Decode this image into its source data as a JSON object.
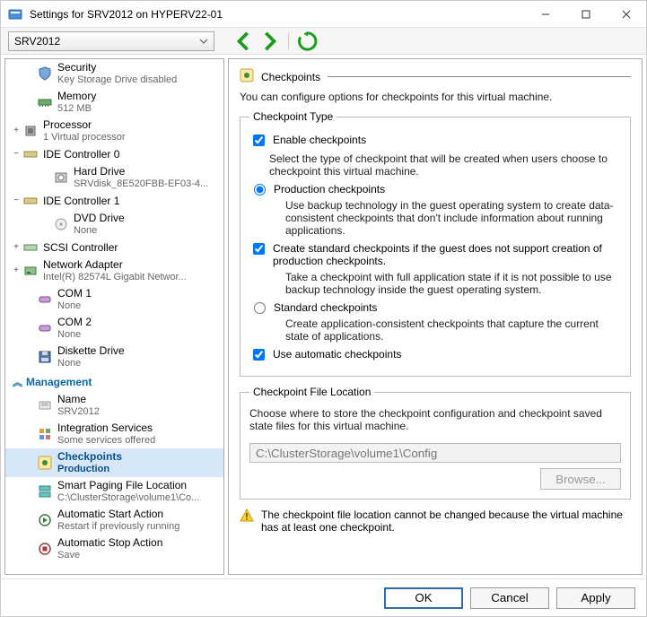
{
  "window": {
    "title": "Settings for SRV2012 on HYPERV22-01"
  },
  "toolbar": {
    "vm_selected": "SRV2012"
  },
  "nav": {
    "hardware": [
      {
        "id": "security",
        "label": "Security",
        "sub": "Key Storage Drive disabled",
        "icon": "shield-icon",
        "expander": "",
        "indent": 1
      },
      {
        "id": "memory",
        "label": "Memory",
        "sub": "512 MB",
        "icon": "memory-icon",
        "expander": "",
        "indent": 1
      },
      {
        "id": "processor",
        "label": "Processor",
        "sub": "1 Virtual processor",
        "icon": "cpu-icon",
        "expander": "+",
        "indent": 0
      },
      {
        "id": "ide0",
        "label": "IDE Controller 0",
        "sub": "",
        "icon": "ide-icon",
        "expander": "−",
        "indent": 0
      },
      {
        "id": "hard-drive",
        "label": "Hard Drive",
        "sub": "SRVdisk_8E520FBB-EF03-4...",
        "icon": "disk-icon",
        "expander": "",
        "indent": 2
      },
      {
        "id": "ide1",
        "label": "IDE Controller 1",
        "sub": "",
        "icon": "ide-icon",
        "expander": "−",
        "indent": 0
      },
      {
        "id": "dvd",
        "label": "DVD Drive",
        "sub": "None",
        "icon": "dvd-icon",
        "expander": "",
        "indent": 2
      },
      {
        "id": "scsi",
        "label": "SCSI Controller",
        "sub": "",
        "icon": "scsi-icon",
        "expander": "+",
        "indent": 0
      },
      {
        "id": "nic",
        "label": "Network Adapter",
        "sub": "Intel(R) 82574L Gigabit Networ...",
        "icon": "nic-icon",
        "expander": "+",
        "indent": 0
      },
      {
        "id": "com1",
        "label": "COM 1",
        "sub": "None",
        "icon": "com-icon",
        "expander": "",
        "indent": 1
      },
      {
        "id": "com2",
        "label": "COM 2",
        "sub": "None",
        "icon": "com-icon",
        "expander": "",
        "indent": 1
      },
      {
        "id": "diskette",
        "label": "Diskette Drive",
        "sub": "None",
        "icon": "floppy-icon",
        "expander": "",
        "indent": 1
      }
    ],
    "management_header": "Management",
    "management": [
      {
        "id": "name",
        "label": "Name",
        "sub": "SRV2012",
        "icon": "tag-icon"
      },
      {
        "id": "integration",
        "label": "Integration Services",
        "sub": "Some services offered",
        "icon": "services-icon"
      },
      {
        "id": "checkpoints",
        "label": "Checkpoints",
        "sub": "Production",
        "icon": "checkpoint-icon",
        "selected": true
      },
      {
        "id": "paging",
        "label": "Smart Paging File Location",
        "sub": "C:\\ClusterStorage\\volume1\\Co...",
        "icon": "paging-icon"
      },
      {
        "id": "autostart",
        "label": "Automatic Start Action",
        "sub": "Restart if previously running",
        "icon": "autostart-icon"
      },
      {
        "id": "autostop",
        "label": "Automatic Stop Action",
        "sub": "Save",
        "icon": "autostop-icon"
      }
    ]
  },
  "content": {
    "header": "Checkpoints",
    "intro": "You can configure options for checkpoints for this virtual machine.",
    "type_group": "Checkpoint Type",
    "enable_label": "Enable checkpoints",
    "enable_checked": true,
    "select_type_desc": "Select the type of checkpoint that will be created when users choose to checkpoint this virtual machine.",
    "prod_label": "Production checkpoints",
    "prod_selected": true,
    "prod_desc": "Use backup technology in the guest operating system to create data-consistent checkpoints that don't include information about running applications.",
    "fallback_label": "Create standard checkpoints if the guest does not support creation of production checkpoints.",
    "fallback_checked": true,
    "fallback_desc": "Take a checkpoint with full application state if it is not possible to use backup technology inside the guest operating system.",
    "std_label": "Standard checkpoints",
    "std_selected": false,
    "std_desc": "Create application-consistent checkpoints that capture the current state of applications.",
    "auto_label": "Use automatic checkpoints",
    "auto_checked": true,
    "loc_group": "Checkpoint File Location",
    "loc_desc": "Choose where to store the checkpoint configuration and checkpoint saved state files for this virtual machine.",
    "loc_path": "C:\\ClusterStorage\\volume1\\Config",
    "browse_label": "Browse...",
    "warning_text": "The checkpoint file location cannot be changed because the virtual machine has at least one checkpoint."
  },
  "footer": {
    "ok": "OK",
    "cancel": "Cancel",
    "apply": "Apply"
  }
}
